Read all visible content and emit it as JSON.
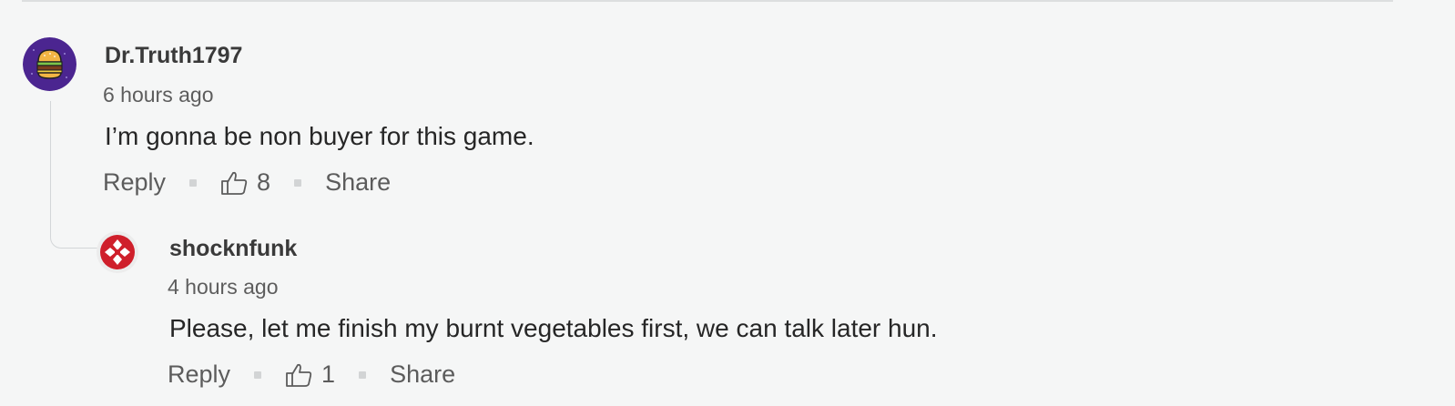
{
  "comments": [
    {
      "username": "Dr.Truth1797",
      "timestamp": "6 hours ago",
      "text": "I’m gonna be non buyer for this game.",
      "actions": {
        "reply": "Reply",
        "likes": "8",
        "share": "Share"
      },
      "avatar_icon": "burger-icon",
      "avatar_color": "#4b2590"
    },
    {
      "username": "shocknfunk",
      "timestamp": "4 hours ago",
      "text": "Please, let me finish my burnt vegetables first, we can talk later hun.",
      "actions": {
        "reply": "Reply",
        "likes": "1",
        "share": "Share"
      },
      "avatar_icon": "ign-logo-icon",
      "avatar_color": "#cf1f2b"
    }
  ]
}
